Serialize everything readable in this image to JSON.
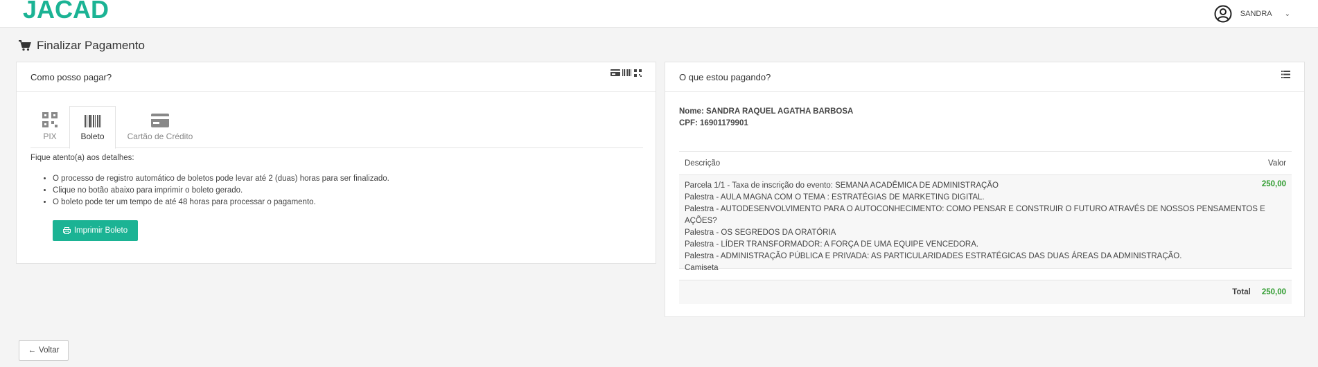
{
  "header": {
    "logo": "JACAD",
    "user_name": "SANDRA",
    "brand_color": "#1bb394"
  },
  "page": {
    "title": "Finalizar Pagamento"
  },
  "payment_panel": {
    "title": "Como posso pagar?",
    "tabs": [
      {
        "label": "PIX",
        "icon": "qr-icon",
        "active": false
      },
      {
        "label": "Boleto",
        "icon": "barcode-icon",
        "active": true
      },
      {
        "label": "Cartão de Crédito",
        "icon": "credit-card-icon",
        "active": false
      }
    ],
    "details_title": "Fique atento(a) aos detalhes:",
    "details": [
      "O processo de registro automático de boletos pode levar até 2 (duas) horas para ser finalizado.",
      "Clique no botão abaixo para imprimir o boleto gerado.",
      "O boleto pode ter um tempo de até 48 horas para processar o pagamento."
    ],
    "print_button": "Imprimir Boleto"
  },
  "summary_panel": {
    "title": "O que estou pagando?",
    "name_line": "Nome: SANDRA RAQUEL AGATHA BARBOSA",
    "cpf_line": "CPF: 16901179901",
    "columns": {
      "description": "Descrição",
      "value": "Valor"
    },
    "items": [
      "Parcela 1/1 - Taxa de inscrição do evento: SEMANA ACADÊMICA DE ADMINISTRAÇÃO",
      "Palestra - AULA MAGNA COM O TEMA : ESTRATÉGIAS DE MARKETING DIGITAL.",
      "Palestra - AUTODESENVOLVIMENTO PARA O AUTOCONHECIMENTO: COMO PENSAR E CONSTRUIR O FUTURO ATRAVÉS DE NOSSOS PENSAMENTOS E AÇÕES?",
      "Palestra - OS SEGREDOS DA ORATÓRIA",
      "Palestra - LÍDER TRANSFORMADOR: A FORÇA DE UMA EQUIPE VENCEDORA.",
      "Palestra - ADMINISTRAÇÃO PÚBLICA E PRIVADA: AS PARTICULARIDADES ESTRATÉGICAS DAS DUAS ÁREAS DA ADMINISTRAÇÃO.",
      "Camiseta"
    ],
    "item_value": "250,00",
    "total_label": "Total",
    "total_value": "250,00",
    "value_color": "#2c9a2c"
  },
  "footer": {
    "back_button": "Voltar"
  }
}
